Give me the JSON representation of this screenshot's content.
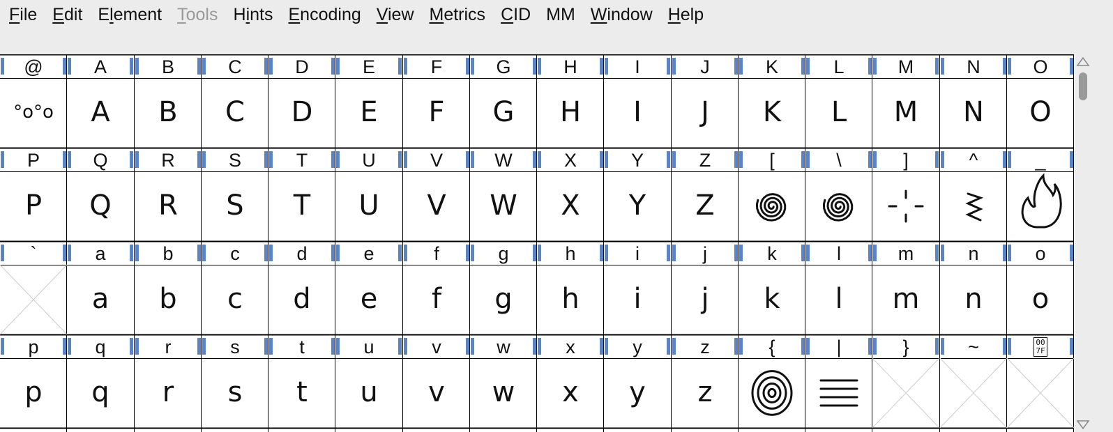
{
  "menubar": {
    "items": [
      {
        "label": "File",
        "accel": "F",
        "disabled": false
      },
      {
        "label": "Edit",
        "accel": "E",
        "disabled": false
      },
      {
        "label": "Element",
        "accel": "l",
        "disabled": false
      },
      {
        "label": "Tools",
        "accel": "T",
        "disabled": true
      },
      {
        "label": "Hints",
        "accel": "i",
        "disabled": false
      },
      {
        "label": "Encoding",
        "accel": "E",
        "disabled": false
      },
      {
        "label": "View",
        "accel": "V",
        "disabled": false
      },
      {
        "label": "Metrics",
        "accel": "M",
        "disabled": false
      },
      {
        "label": "CID",
        "accel": "C",
        "disabled": false
      },
      {
        "label": "MM",
        "accel": "",
        "disabled": false
      },
      {
        "label": "Window",
        "accel": "W",
        "disabled": false
      },
      {
        "label": "Help",
        "accel": "H",
        "disabled": false
      }
    ]
  },
  "font_view": {
    "rows": [
      {
        "labels": [
          "@",
          "A",
          "B",
          "C",
          "D",
          "E",
          "F",
          "G",
          "H",
          "I",
          "J",
          "K",
          "L",
          "M",
          "N",
          "O"
        ],
        "glyphs": [
          "°o°o",
          "A",
          "B",
          "C",
          "D",
          "E",
          "F",
          "G",
          "H",
          "I",
          "J",
          "K",
          "L",
          "M",
          "N",
          "O"
        ]
      },
      {
        "labels": [
          "P",
          "Q",
          "R",
          "S",
          "T",
          "U",
          "V",
          "W",
          "X",
          "Y",
          "Z",
          "[",
          "\\",
          "]",
          "^",
          "_"
        ],
        "glyphs": [
          "P",
          "Q",
          "R",
          "S",
          "T",
          "U",
          "V",
          "W",
          "X",
          "Y",
          "Z",
          "spiral-glyph",
          "spiral-glyph",
          "sparkle-glyph",
          "zigzag-glyph",
          "flame-glyph"
        ]
      },
      {
        "labels": [
          "`",
          "a",
          "b",
          "c",
          "d",
          "e",
          "f",
          "g",
          "h",
          "i",
          "j",
          "k",
          "l",
          "m",
          "n",
          "o"
        ],
        "glyphs": [
          "empty",
          "a",
          "b",
          "c",
          "d",
          "e",
          "f",
          "g",
          "h",
          "i",
          "j",
          "k",
          "l",
          "m",
          "n",
          "o"
        ]
      },
      {
        "labels": [
          "p",
          "q",
          "r",
          "s",
          "t",
          "u",
          "v",
          "w",
          "x",
          "y",
          "z",
          "{",
          "|",
          "}",
          "~",
          "007F"
        ],
        "glyphs": [
          "p",
          "q",
          "r",
          "s",
          "t",
          "u",
          "v",
          "w",
          "x",
          "y",
          "z",
          "target-glyph",
          "lines-glyph",
          "empty",
          "empty",
          "empty"
        ]
      }
    ]
  },
  "colors": {
    "marker": "#5b84c4",
    "ink": "#111111"
  }
}
